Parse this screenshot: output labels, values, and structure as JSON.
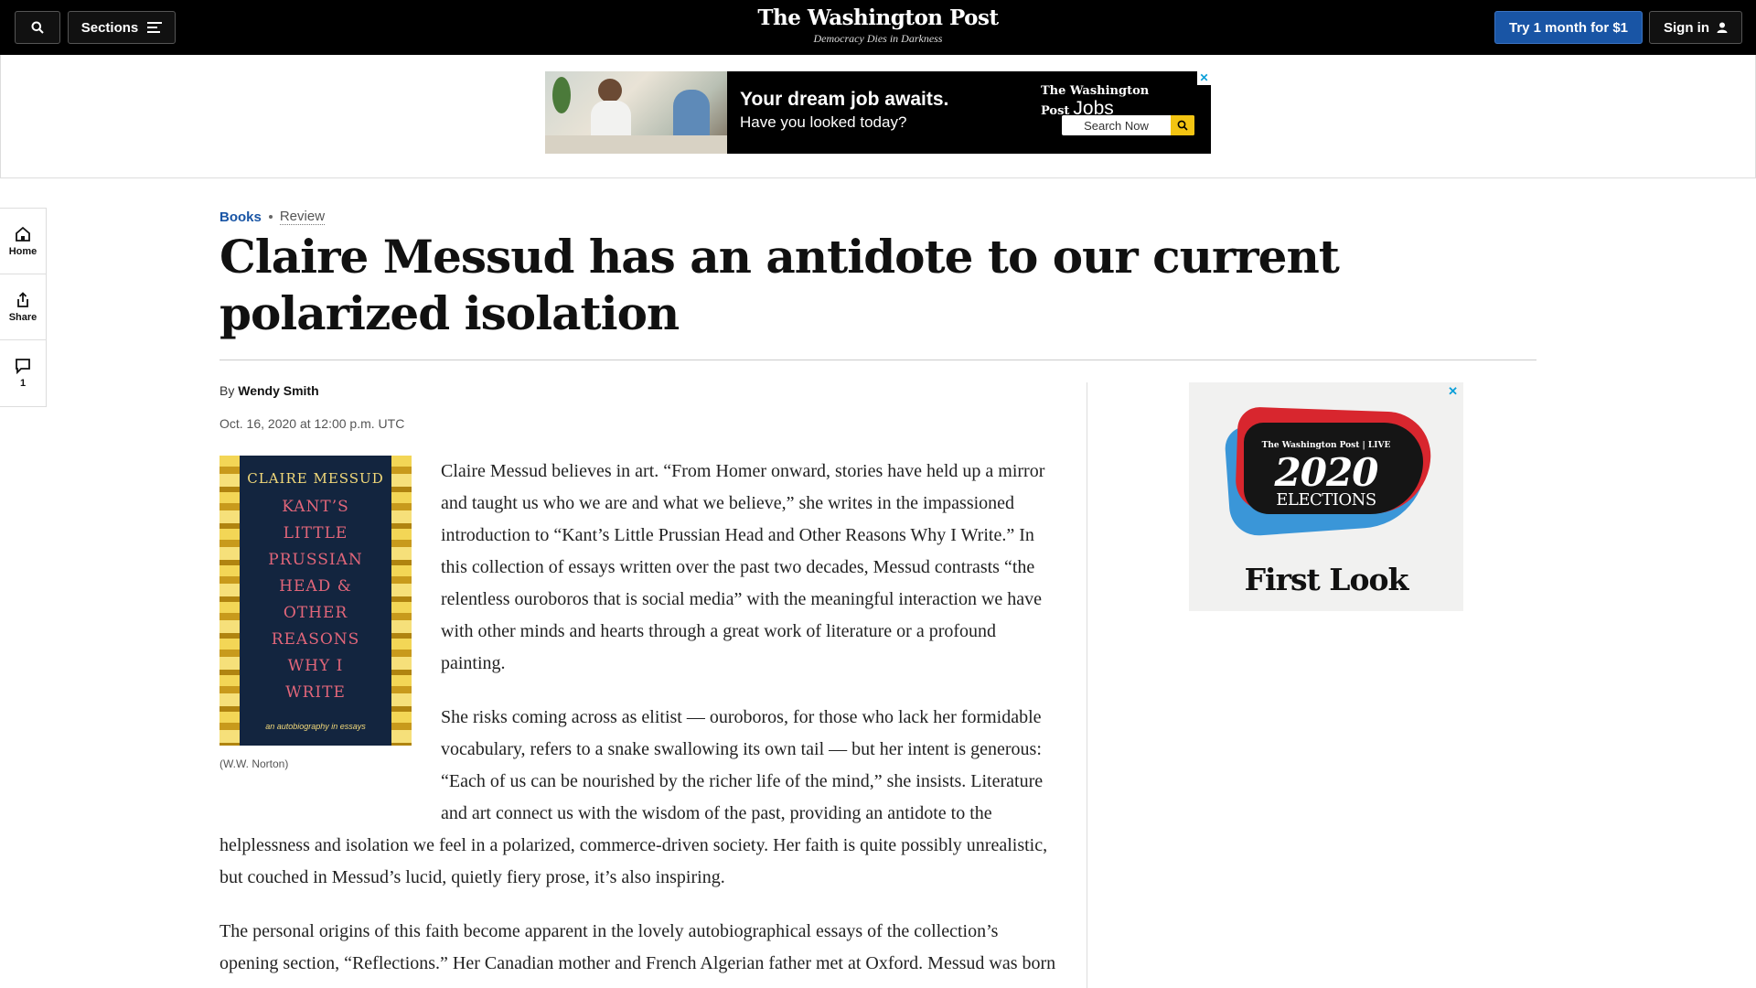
{
  "nav": {
    "sections_label": "Sections",
    "masthead_name": "The Washington Post",
    "masthead_tagline": "Democracy Dies in Darkness",
    "try_label": "Try 1 month for $1",
    "signin_label": "Sign in"
  },
  "top_ad": {
    "headline": "Your dream job awaits.",
    "subline": "Have you looked today?",
    "logo_text": "The Washington Post",
    "logo_suffix": "Jobs",
    "search_label": "Search Now",
    "close": "✕"
  },
  "rail": {
    "home_label": "Home",
    "share_label": "Share",
    "comments_count": "1"
  },
  "article": {
    "section": "Books",
    "label": "Review",
    "headline": "Claire Messud has an antidote to our current polarized isolation",
    "byline_prefix": "By",
    "author": "Wendy Smith",
    "date": "Oct. 16, 2020 at 12:00 p.m. UTC",
    "image_caption": "(W.W. Norton)",
    "paragraphs": [
      "Claire Messud believes in art. “From Homer onward, stories have held up a mirror and taught us who we are and what we believe,” she writes in the impassioned introduction to “Kant’s Little Prussian Head and Other Reasons Why I Write.” In this collection of essays written over the past two decades, Messud contrasts “the relentless ouroboros that is social media” with the meaningful interaction we have with other minds and hearts through a great work of literature or a profound painting.",
      "She risks coming across as elitist — ouroboros, for those who lack her formidable vocabulary, refers to a snake swallowing its own tail — but her intent is generous: “Each of us can be nourished by the richer life of the mind,” she insists. Literature and art connect us with the wisdom of the past, providing an antidote to the helplessness and isolation we feel in a polarized, commerce-driven society. Her faith is quite possibly unrealistic, but couched in Messud’s lucid, quietly fiery prose, it’s also inspiring.",
      "The personal origins of this faith become apparent in the lovely autobiographical essays of the collection’s opening section, “Reflections.” Her Canadian mother and French Algerian father met at Oxford. Messud was born"
    ]
  },
  "book_cover": {
    "author": "CLAIRE MESSUD",
    "title_lines": [
      "KANT’S",
      "LITTLE",
      "PRUSSIAN",
      "HEAD &",
      "OTHER",
      "REASONS",
      "WHY I",
      "WRITE"
    ],
    "subtitle": "an autobiography in essays"
  },
  "side_ad": {
    "logo_text": "The Washington Post | LIVE",
    "year": "2020",
    "event": "ELECTIONS",
    "tagline": "First Look",
    "close": "✕"
  },
  "colors": {
    "accent_blue": "#1955a5",
    "nav_bg": "#000000",
    "jobs_yellow": "#f3c412"
  }
}
